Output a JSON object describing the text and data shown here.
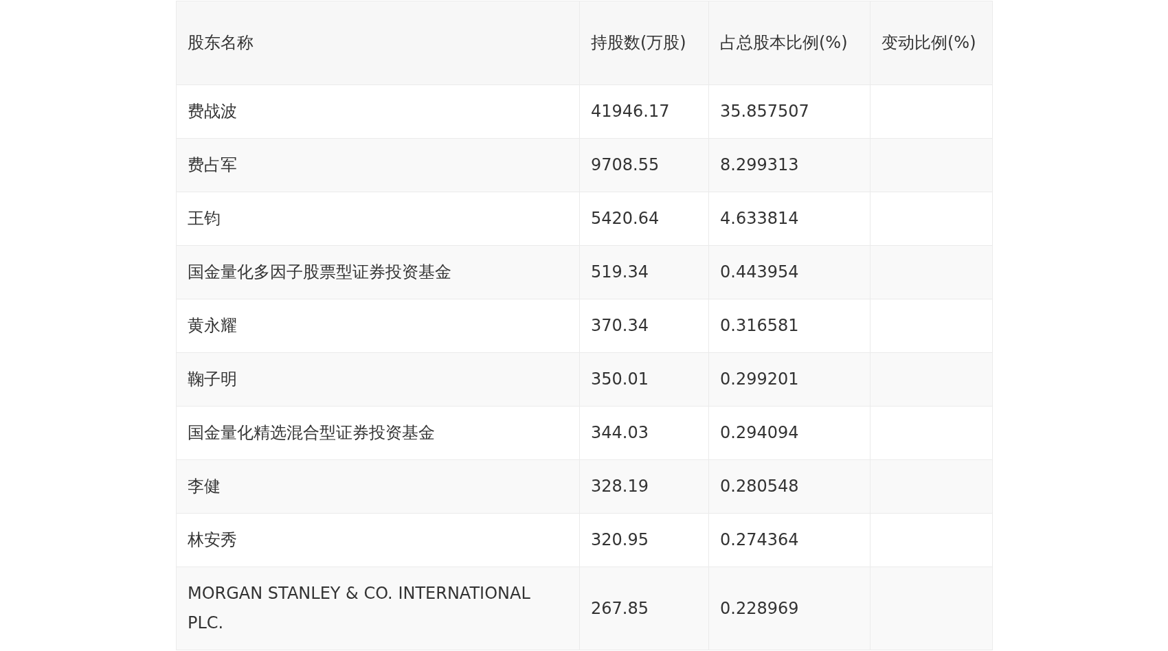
{
  "table": {
    "columns": [
      "股东名称",
      "持股数(万股)",
      "占总股本比例(%)",
      "变动比例(%)"
    ],
    "rows": [
      [
        "费战波",
        "41946.17",
        "35.857507",
        ""
      ],
      [
        "费占军",
        "9708.55",
        "8.299313",
        ""
      ],
      [
        "王钧",
        "5420.64",
        "4.633814",
        ""
      ],
      [
        "国金量化多因子股票型证券投资基金",
        "519.34",
        "0.443954",
        ""
      ],
      [
        "黄永耀",
        "370.34",
        "0.316581",
        ""
      ],
      [
        "鞠子明",
        "350.01",
        "0.299201",
        ""
      ],
      [
        "国金量化精选混合型证券投资基金",
        "344.03",
        "0.294094",
        ""
      ],
      [
        "李健",
        "328.19",
        "0.280548",
        ""
      ],
      [
        "林安秀",
        "320.95",
        "0.274364",
        ""
      ],
      [
        "MORGAN STANLEY & CO. INTERNATIONAL PLC.",
        "267.85",
        "0.228969",
        ""
      ]
    ]
  }
}
